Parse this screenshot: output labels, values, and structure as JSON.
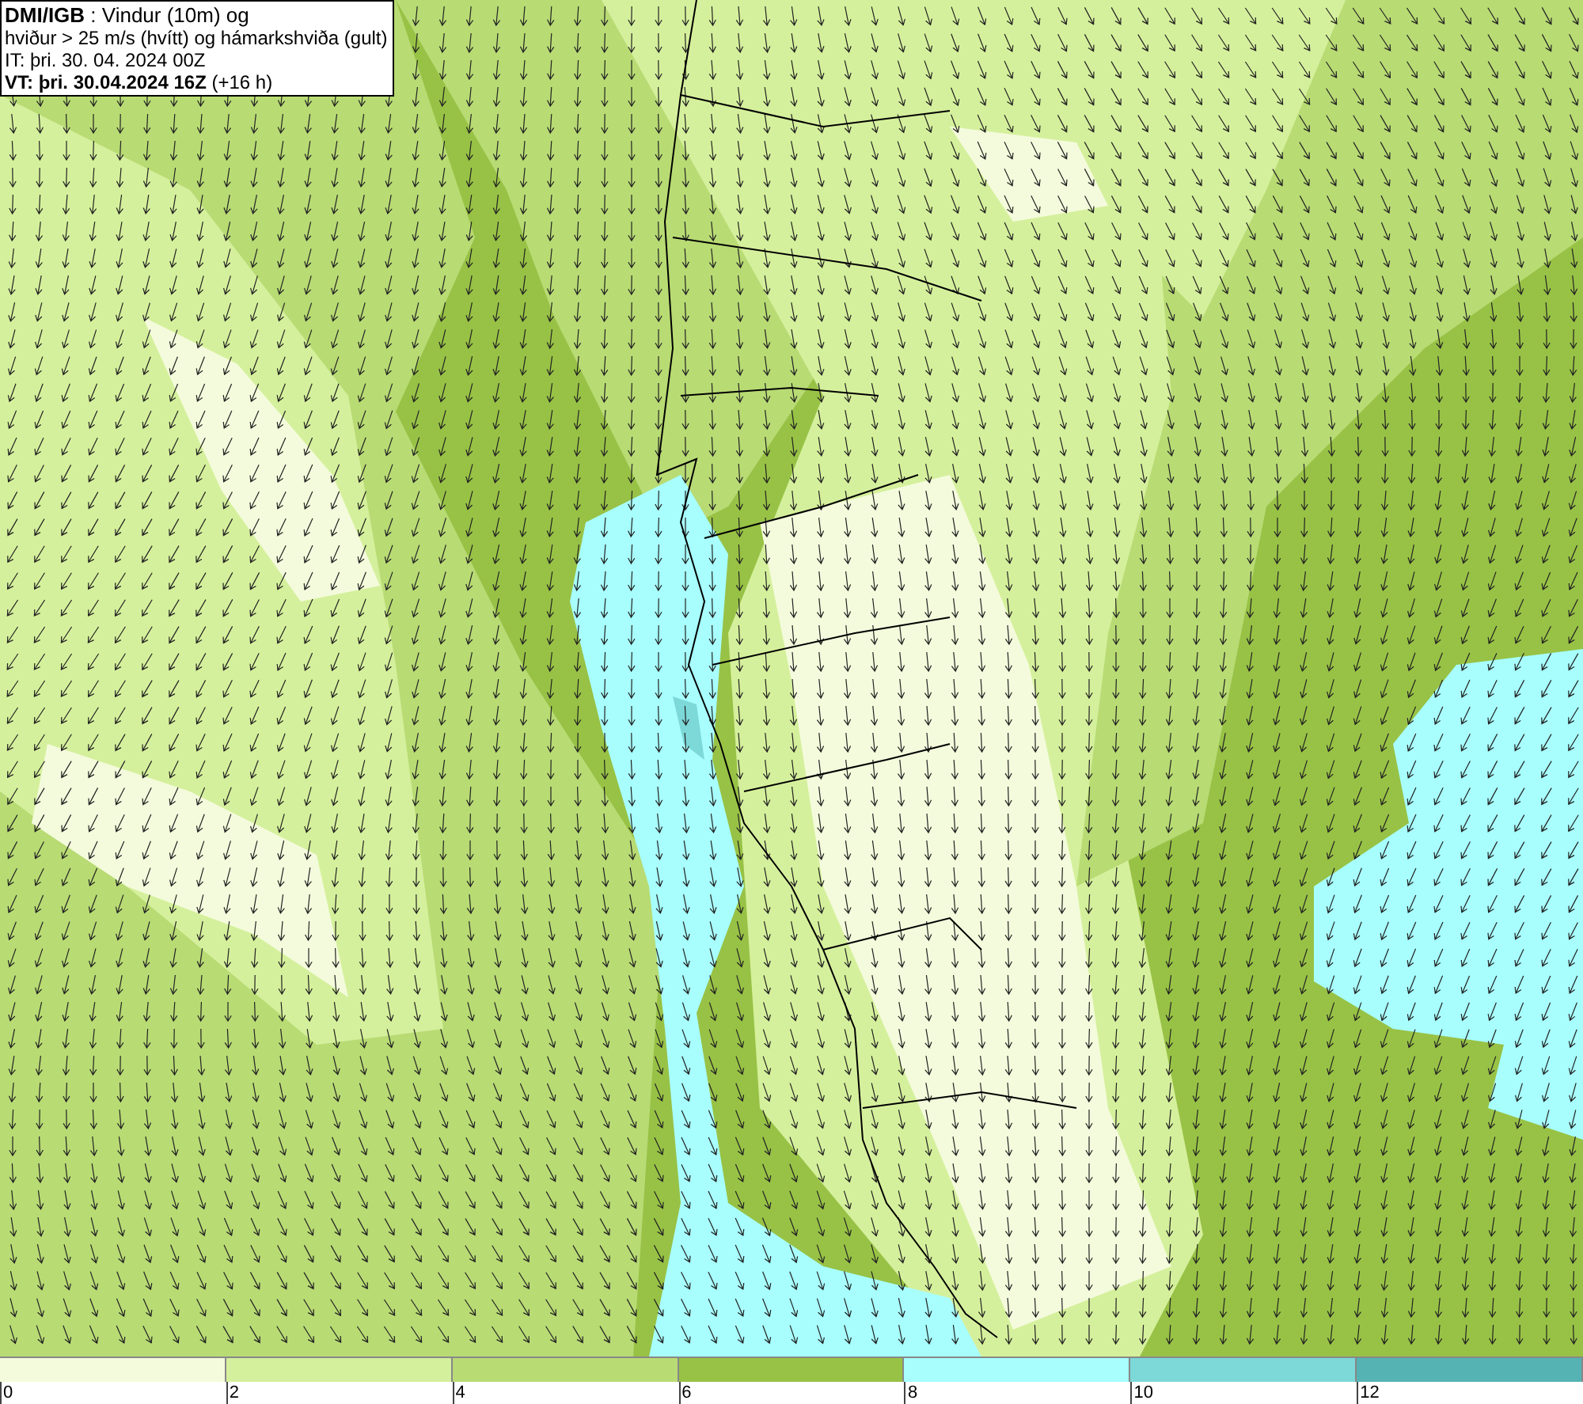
{
  "info_box": {
    "lines": [
      "**DMI/IGB** : Vindur (10m) og",
      "hviður > 25 m/s (hvítt) og hámarkshviða (gult)",
      "IT: þri. 30. 04. 2024 00Z",
      "**VT: þri. 30.04.2024 16Z** (+16 h)"
    ]
  },
  "legend": {
    "bins": [
      {
        "color": "#f4fbdc"
      },
      {
        "color": "#d5f09c"
      },
      {
        "color": "#b8db74"
      },
      {
        "color": "#98c246"
      },
      {
        "color": "#a8fdfd"
      },
      {
        "color": "#7dd8d8"
      },
      {
        "color": "#55b3b3"
      }
    ],
    "ticks": [
      "0",
      "2",
      "4",
      "6",
      "8",
      "10",
      "12"
    ]
  }
}
